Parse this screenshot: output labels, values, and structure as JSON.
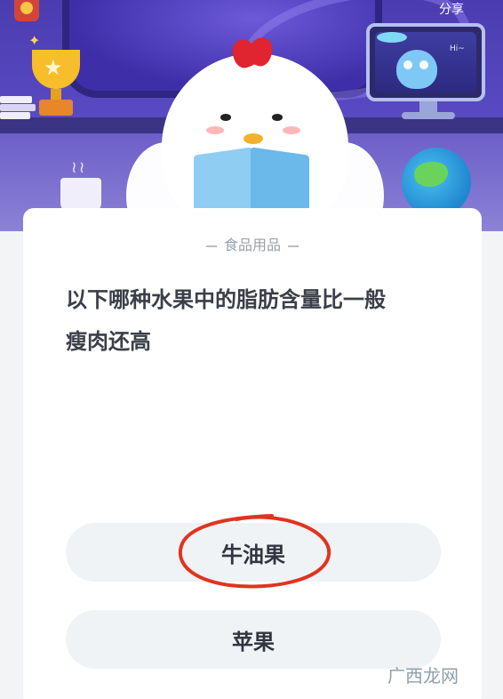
{
  "header": {
    "share_label": "分享",
    "monitor_greeting": "Hi~"
  },
  "quiz": {
    "category": "食品用品",
    "question_line1": "以下哪种水果中的脂肪含量比一般",
    "question_line2": "瘦肉还高",
    "options": [
      {
        "label": "牛油果",
        "marked": true
      },
      {
        "label": "苹果",
        "marked": false
      }
    ]
  },
  "watermark": {
    "text": "广西龙网"
  },
  "colors": {
    "hero_purple": "#4b3cb0",
    "card_bg": "#ffffff",
    "option_bg": "#eff3f5",
    "annotation_red": "#e2331f"
  },
  "icons": [
    "trophy-icon",
    "sparkle-icon",
    "badge-icon",
    "ufo-icon",
    "alien-icon",
    "globe-icon",
    "mug-icon",
    "share-icon"
  ]
}
